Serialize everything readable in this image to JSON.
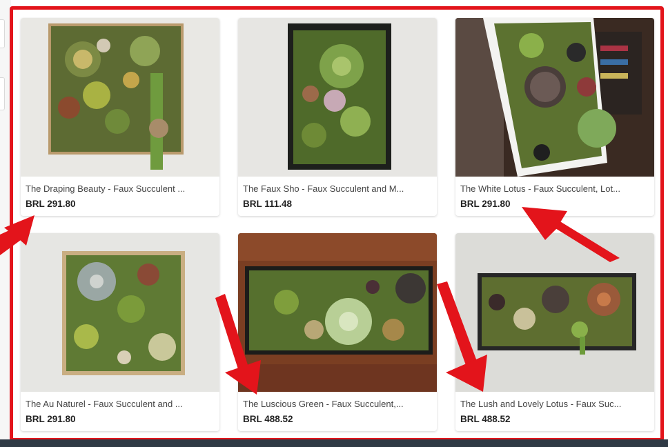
{
  "listings": [
    {
      "title": "The Draping Beauty - Faux Succulent ...",
      "price": "BRL 291.80"
    },
    {
      "title": "The Faux Sho - Faux Succulent and M...",
      "price": "BRL 111.48"
    },
    {
      "title": "The White Lotus - Faux Succulent, Lot...",
      "price": "BRL 291.80"
    },
    {
      "title": "The Au Naturel - Faux Succulent and ...",
      "price": "BRL 291.80"
    },
    {
      "title": "The Luscious Green - Faux Succulent,...",
      "price": "BRL 488.52"
    },
    {
      "title": "The Lush and Lovely Lotus - Faux Suc...",
      "price": "BRL 488.52"
    }
  ],
  "colors": {
    "highlight": "#e3141b",
    "price_text": "#222222"
  }
}
